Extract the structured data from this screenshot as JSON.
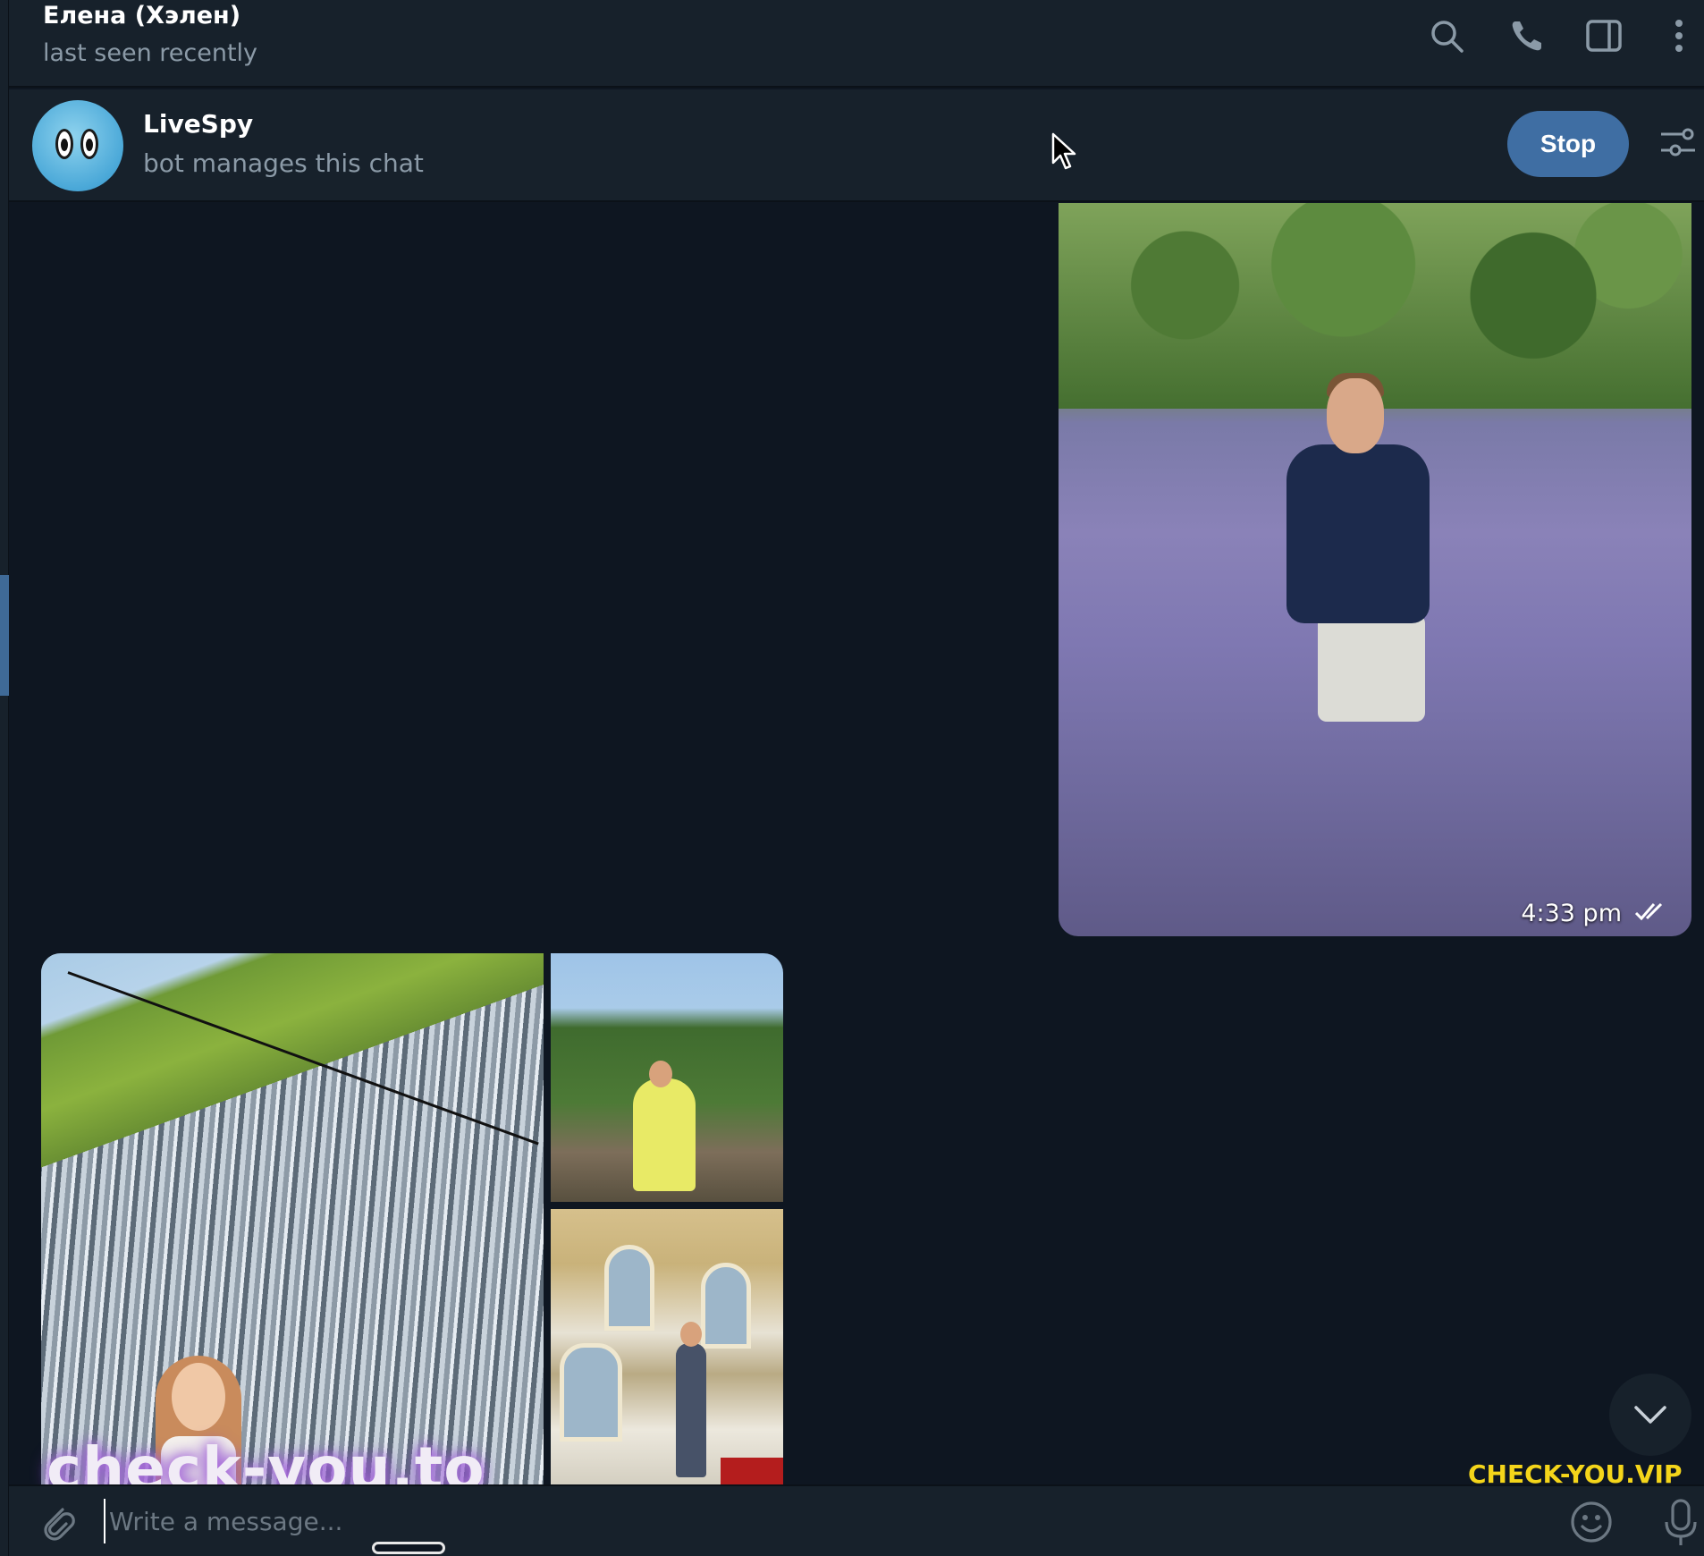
{
  "header": {
    "contact_name": "Елена (Хэлен)",
    "status": "last seen recently",
    "icons": [
      "search-icon",
      "phone-icon",
      "sidebar-toggle-icon",
      "more-icon"
    ]
  },
  "pinned_bot": {
    "name": "LiveSpy",
    "subtitle": "bot manages this chat",
    "stop_label": "Stop",
    "settings_icon": "settings-sliders-icon"
  },
  "messages": [
    {
      "type": "photo",
      "direction": "outgoing",
      "time": "4:33 pm",
      "status": "read"
    },
    {
      "type": "album",
      "direction": "incoming",
      "photo_count": 3
    }
  ],
  "watermarks": {
    "left": "check-you.to",
    "right": "CHECK-YOU.VIP"
  },
  "composer": {
    "placeholder": "Write a message...",
    "value": ""
  },
  "colors": {
    "background": "#0e1621",
    "panel": "#17212b",
    "accent": "#3f6ea3",
    "muted_text": "#8b9aa7"
  }
}
